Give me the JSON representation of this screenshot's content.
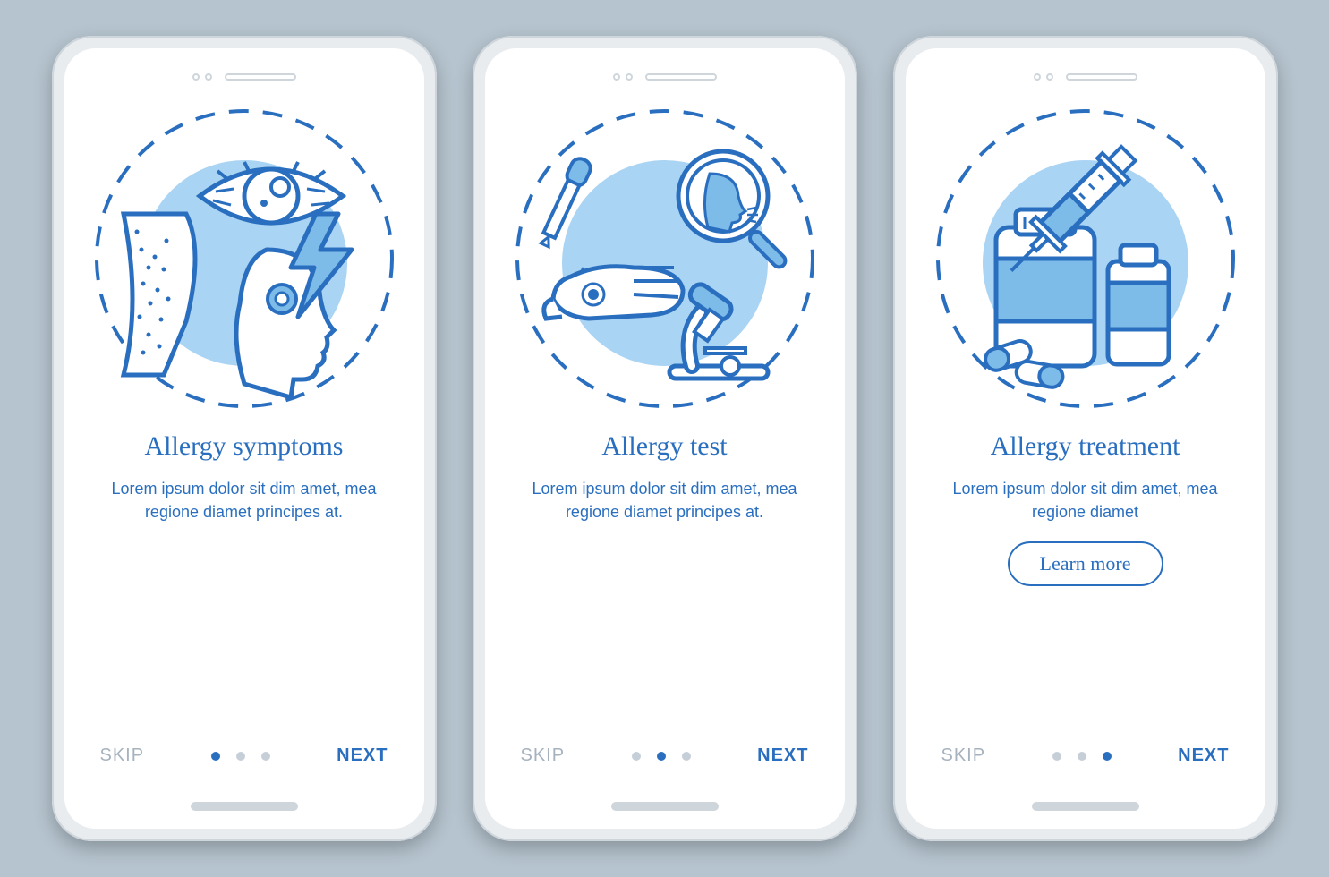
{
  "screens": [
    {
      "icon": "allergy-symptoms",
      "title": "Allergy symptoms",
      "desc": "Lorem ipsum dolor sit dim amet, mea regione diamet principes at.",
      "skip": "SKIP",
      "next": "NEXT",
      "activeDot": 0,
      "showLearnMore": false
    },
    {
      "icon": "allergy-test",
      "title": "Allergy test",
      "desc": "Lorem ipsum dolor sit dim amet, mea regione diamet principes at.",
      "skip": "SKIP",
      "next": "NEXT",
      "activeDot": 1,
      "showLearnMore": false
    },
    {
      "icon": "allergy-treatment",
      "title": "Allergy treatment",
      "desc": "Lorem ipsum dolor sit dim amet, mea regione diamet",
      "skip": "SKIP",
      "next": "NEXT",
      "activeDot": 2,
      "showLearnMore": true,
      "learnMore": "Learn more"
    }
  ],
  "colors": {
    "primary": "#2a6fbf",
    "light": "#aad4f3",
    "fill": "#7dbbe9",
    "bg": "#b6c4cf"
  }
}
